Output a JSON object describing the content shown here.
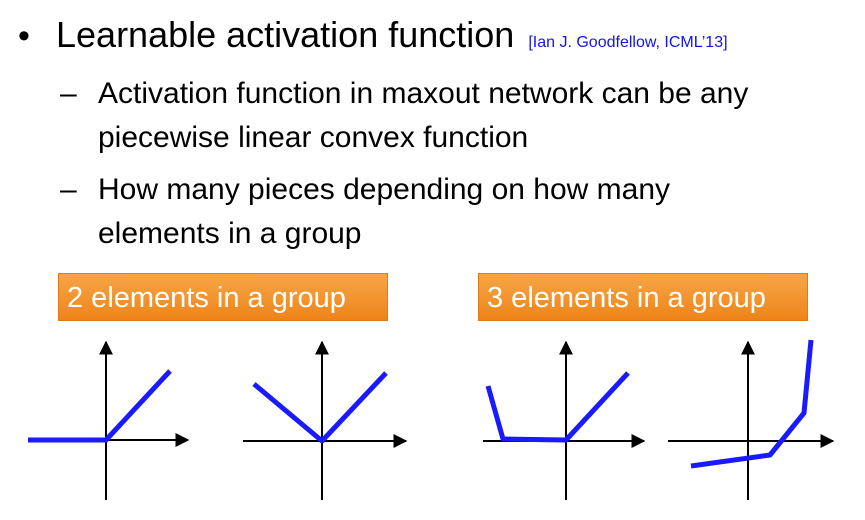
{
  "bullet": {
    "marker": "•",
    "heading": "Learnable activation function",
    "citation": "[Ian J. Goodfellow, ICML’13]"
  },
  "sub_bullets": [
    {
      "dash": "–",
      "lines": [
        "Activation function in maxout network can be any",
        "piecewise linear convex function"
      ]
    },
    {
      "dash": "–",
      "lines": [
        "How many pieces depending on how many",
        "elements in a group"
      ]
    }
  ],
  "badges": {
    "two": "2 elements in a group",
    "three": "3 elements in a group"
  },
  "colors": {
    "badge_orange": "#f0901f",
    "citation_blue": "#1414e6",
    "curve_blue": "#1a1aff",
    "axis": "#000000"
  },
  "plots": [
    {
      "name": "plot-relu",
      "pieces": 2
    },
    {
      "name": "plot-abs",
      "pieces": 2
    },
    {
      "name": "plot-three-flat",
      "pieces": 3
    },
    {
      "name": "plot-three-convex",
      "pieces": 3
    }
  ]
}
